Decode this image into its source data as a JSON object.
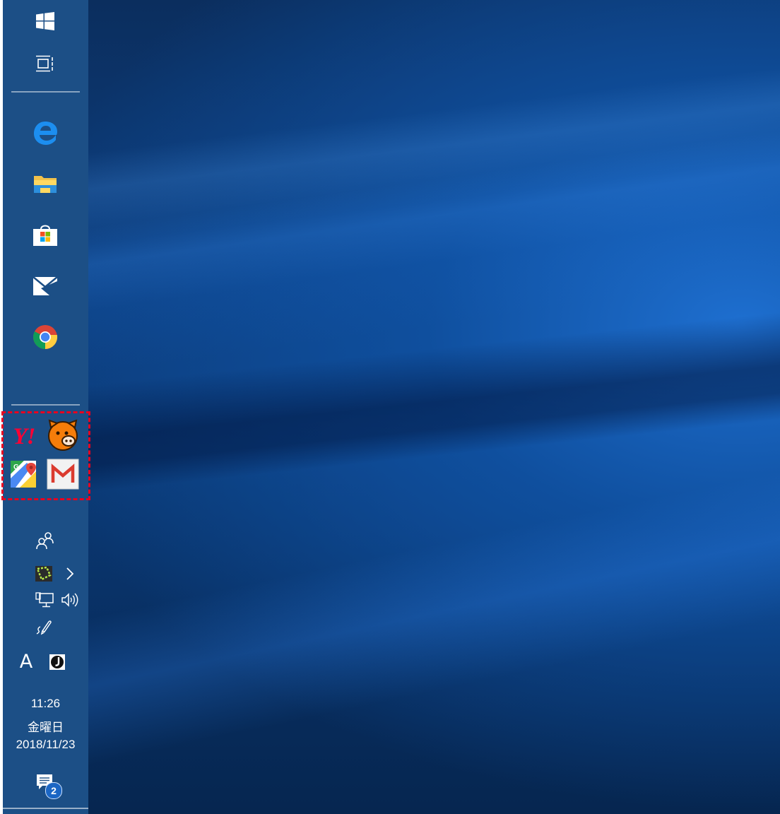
{
  "taskbar": {
    "orientation": "left",
    "background_color": "#1c4f86",
    "top_items": [
      {
        "name": "start-button",
        "icon": "windows-logo-icon"
      },
      {
        "name": "task-view-button",
        "icon": "task-view-icon"
      }
    ],
    "pinned_apps": [
      {
        "name": "Microsoft Edge",
        "icon": "edge-icon"
      },
      {
        "name": "File Explorer",
        "icon": "folder-icon"
      },
      {
        "name": "Microsoft Store",
        "icon": "store-icon"
      },
      {
        "name": "Mail",
        "icon": "mail-icon"
      },
      {
        "name": "Google Chrome",
        "icon": "chrome-icon"
      }
    ],
    "highlighted_apps": [
      {
        "name": "Yahoo!",
        "icon": "yahoo-icon",
        "label": "Y!"
      },
      {
        "name": "Pig app",
        "icon": "pig-icon"
      },
      {
        "name": "Google Maps",
        "icon": "google-maps-icon",
        "label": "G"
      },
      {
        "name": "Gmail",
        "icon": "gmail-icon",
        "label": "M"
      }
    ],
    "highlight_color": "#e8001f"
  },
  "tray": {
    "people_icon": "people-icon",
    "app_tray_icon": "green-app-icon",
    "expand_icon": "chevron-right-icon",
    "network_icon": "network-icon",
    "volume_icon": "volume-icon",
    "pen_icon": "pen-ink-icon",
    "ime_mode": "A",
    "ime_icon": "ime-j-icon",
    "time": "11:26",
    "weekday": "金曜日",
    "date": "2018/11/23",
    "notification_icon": "action-center-icon",
    "notification_count": "2"
  }
}
